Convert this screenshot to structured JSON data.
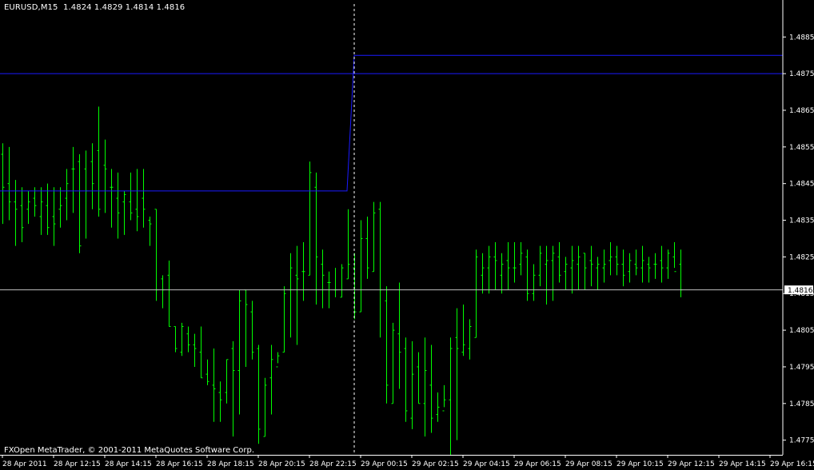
{
  "window": {
    "symbol_ohlc": "EURUSD,M15  1.4824 1.4829 1.4814 1.4816",
    "credit": "FXOpen MetaTrader, © 2001-2011 MetaQuotes Software Corp.",
    "current_price_label": "1.4816"
  },
  "colors": {
    "background": "#000000",
    "bars": "#00ff00",
    "axis": "#ffffff",
    "level_lines": "#1a1aff",
    "bid_line": "#c0c0c0",
    "separator": "#ffffff"
  },
  "chart_data": {
    "type": "ohlc-bar",
    "timeframe": "M15",
    "ylim": [
      1.4771,
      1.4894
    ],
    "y_ticks": [
      "1.4885",
      "1.4875",
      "1.4865",
      "1.4855",
      "1.4845",
      "1.4835",
      "1.4825",
      "1.4815",
      "1.4805",
      "1.4795",
      "1.4785",
      "1.4775"
    ],
    "y_tick_values": [
      1.4885,
      1.4875,
      1.4865,
      1.4855,
      1.4845,
      1.4835,
      1.4825,
      1.4815,
      1.4805,
      1.4795,
      1.4785,
      1.4775
    ],
    "x_ticks": [
      "28 Apr 2011",
      "28 Apr 12:15",
      "28 Apr 14:15",
      "28 Apr 16:15",
      "28 Apr 18:15",
      "28 Apr 20:15",
      "28 Apr 22:15",
      "29 Apr 00:15",
      "29 Apr 02:15",
      "29 Apr 04:15",
      "29 Apr 06:15",
      "29 Apr 08:15",
      "29 Apr 10:15",
      "29 Apr 12:15",
      "29 Apr 14:15",
      "29 Apr 16:15"
    ],
    "levels": [
      {
        "name": "prev-day-high",
        "y": 1.4875
      },
      {
        "name": "prev-day-low",
        "y": 1.4843
      },
      {
        "name": "day-high",
        "y": 1.488
      }
    ],
    "bid_price": 1.4816,
    "bars": [
      [
        1.4853,
        1.4856,
        1.4834,
        1.4844
      ],
      [
        1.4845,
        1.4855,
        1.4835,
        1.484
      ],
      [
        1.484,
        1.4846,
        1.4828,
        1.4838
      ],
      [
        1.4839,
        1.4844,
        1.4829,
        1.4833
      ],
      [
        1.4838,
        1.4843,
        1.4834,
        1.484
      ],
      [
        1.4841,
        1.4844,
        1.4836,
        1.4839
      ],
      [
        1.4836,
        1.4844,
        1.4831,
        1.484
      ],
      [
        1.4839,
        1.4845,
        1.4831,
        1.4833
      ],
      [
        1.4836,
        1.4844,
        1.4828,
        1.4834
      ],
      [
        1.4838,
        1.4844,
        1.4833,
        1.4839
      ],
      [
        1.4841,
        1.4849,
        1.4835,
        1.4845
      ],
      [
        1.4849,
        1.4855,
        1.4837,
        1.4849
      ],
      [
        1.4851,
        1.4853,
        1.4826,
        1.4828
      ],
      [
        1.4849,
        1.4854,
        1.483,
        1.4843
      ],
      [
        1.4851,
        1.4856,
        1.4838,
        1.4845
      ],
      [
        1.4854,
        1.4866,
        1.4836,
        1.4838
      ],
      [
        1.485,
        1.4857,
        1.4837,
        1.4849
      ],
      [
        1.4844,
        1.4849,
        1.4833,
        1.4844
      ],
      [
        1.4841,
        1.4848,
        1.483,
        1.4837
      ],
      [
        1.484,
        1.4843,
        1.4831,
        1.4842
      ],
      [
        1.484,
        1.4848,
        1.4835,
        1.4837
      ],
      [
        1.4838,
        1.4849,
        1.4832,
        1.4836
      ],
      [
        1.4841,
        1.4849,
        1.4833,
        1.4838
      ],
      [
        1.4835,
        1.4836,
        1.4828,
        1.4834
      ],
      [
        1.4838,
        1.4838,
        1.4813,
        1.4816
      ],
      [
        1.4819,
        1.482,
        1.4811,
        1.4816
      ],
      [
        1.482,
        1.4824,
        1.4806,
        1.4806
      ],
      [
        1.4806,
        1.4806,
        1.4799,
        1.48
      ],
      [
        1.4799,
        1.4807,
        1.4798,
        1.4806
      ],
      [
        1.4804,
        1.4806,
        1.4799,
        1.4801
      ],
      [
        1.4801,
        1.4804,
        1.4795,
        1.48
      ],
      [
        1.4799,
        1.4806,
        1.4792,
        1.4792
      ],
      [
        1.4793,
        1.4797,
        1.479,
        1.4791
      ],
      [
        1.479,
        1.48,
        1.478,
        1.4789
      ],
      [
        1.4788,
        1.4791,
        1.478,
        1.4786
      ],
      [
        1.4788,
        1.4797,
        1.4785,
        1.4797
      ],
      [
        1.48,
        1.4802,
        1.4776,
        1.4794
      ],
      [
        1.4794,
        1.4816,
        1.4782,
        1.4813
      ],
      [
        1.4816,
        1.4816,
        1.4795,
        1.4812
      ],
      [
        1.481,
        1.4813,
        1.4797,
        1.4799
      ],
      [
        1.48,
        1.4801,
        1.4774,
        1.4778
      ],
      [
        1.4776,
        1.4792,
        1.4776,
        1.479
      ],
      [
        1.4792,
        1.4801,
        1.4782,
        1.4797
      ],
      [
        1.4795,
        1.4799,
        1.4796,
        1.4798
      ],
      [
        1.4799,
        1.4817,
        1.4799,
        1.4815
      ],
      [
        1.4816,
        1.4826,
        1.4803,
        1.4822
      ],
      [
        1.482,
        1.4828,
        1.4801,
        1.4819
      ],
      [
        1.4821,
        1.4829,
        1.4813,
        1.4821
      ],
      [
        1.482,
        1.4851,
        1.482,
        1.4848
      ],
      [
        1.4844,
        1.4848,
        1.4812,
        1.4825
      ],
      [
        1.4823,
        1.4827,
        1.4811,
        1.482
      ],
      [
        1.4818,
        1.4821,
        1.4811,
        1.4818
      ],
      [
        1.4816,
        1.4822,
        1.4814,
        1.4816
      ],
      [
        1.4814,
        1.4823,
        1.4814,
        1.4822
      ],
      [
        1.4819,
        1.4838,
        1.4819,
        1.4823
      ],
      [
        1.4822,
        1.4826,
        1.4808,
        1.481
      ],
      [
        1.481,
        1.4835,
        1.481,
        1.483
      ],
      [
        1.483,
        1.4836,
        1.4819,
        1.4822
      ],
      [
        1.4821,
        1.484,
        1.4821,
        1.4837
      ],
      [
        1.4838,
        1.484,
        1.4803,
        1.4816
      ],
      [
        1.4813,
        1.4817,
        1.4785,
        1.479
      ],
      [
        1.4785,
        1.4807,
        1.4785,
        1.4805
      ],
      [
        1.4804,
        1.4818,
        1.4789,
        1.4799
      ],
      [
        1.48,
        1.4803,
        1.478,
        1.4783
      ],
      [
        1.4781,
        1.4802,
        1.4778,
        1.4793
      ],
      [
        1.4795,
        1.4799,
        1.4785,
        1.4785
      ],
      [
        1.4785,
        1.4803,
        1.4776,
        1.4794
      ],
      [
        1.479,
        1.4801,
        1.4777,
        1.4781
      ],
      [
        1.4782,
        1.4788,
        1.478,
        1.4784
      ],
      [
        1.4783,
        1.479,
        1.4784,
        1.4786
      ],
      [
        1.4786,
        1.4803,
        1.4771,
        1.48
      ],
      [
        1.4803,
        1.4811,
        1.4775,
        1.48
      ],
      [
        1.4799,
        1.4812,
        1.4798,
        1.4801
      ],
      [
        1.48,
        1.4808,
        1.4797,
        1.4806
      ],
      [
        1.4803,
        1.4827,
        1.4803,
        1.4825
      ],
      [
        1.482,
        1.4826,
        1.4815,
        1.4822
      ],
      [
        1.4822,
        1.4828,
        1.4815,
        1.4825
      ],
      [
        1.4825,
        1.4829,
        1.4816,
        1.4824
      ],
      [
        1.482,
        1.4826,
        1.4815,
        1.4823
      ],
      [
        1.4824,
        1.4829,
        1.4816,
        1.4822
      ],
      [
        1.4822,
        1.4829,
        1.4818,
        1.4822
      ],
      [
        1.4823,
        1.4829,
        1.482,
        1.4826
      ],
      [
        1.4825,
        1.4827,
        1.4813,
        1.4815
      ],
      [
        1.4815,
        1.4823,
        1.4813,
        1.482
      ],
      [
        1.482,
        1.4828,
        1.4817,
        1.4826
      ],
      [
        1.4823,
        1.4828,
        1.4812,
        1.4824
      ],
      [
        1.4824,
        1.4828,
        1.4813,
        1.4826
      ],
      [
        1.4825,
        1.4829,
        1.4818,
        1.482
      ],
      [
        1.4821,
        1.4825,
        1.4816,
        1.4823
      ],
      [
        1.4822,
        1.4828,
        1.4815,
        1.4824
      ],
      [
        1.4823,
        1.4828,
        1.4816,
        1.4825
      ],
      [
        1.4826,
        1.4826,
        1.4816,
        1.4822
      ],
      [
        1.4824,
        1.4828,
        1.4817,
        1.4823
      ],
      [
        1.4822,
        1.4825,
        1.4816,
        1.4823
      ],
      [
        1.4822,
        1.4827,
        1.4818,
        1.4823
      ],
      [
        1.4824,
        1.4829,
        1.482,
        1.4825
      ],
      [
        1.4825,
        1.4828,
        1.482,
        1.4823
      ],
      [
        1.4823,
        1.4827,
        1.4817,
        1.482
      ],
      [
        1.4821,
        1.4826,
        1.4818,
        1.4824
      ],
      [
        1.4823,
        1.4827,
        1.482,
        1.4822
      ],
      [
        1.4822,
        1.4828,
        1.4818,
        1.4824
      ],
      [
        1.4823,
        1.4825,
        1.4818,
        1.4822
      ],
      [
        1.4823,
        1.4826,
        1.4819,
        1.4823
      ],
      [
        1.4824,
        1.4828,
        1.4818,
        1.4822
      ],
      [
        1.4822,
        1.4827,
        1.4819,
        1.4826
      ],
      [
        1.4825,
        1.4829,
        1.4822,
        1.4821
      ],
      [
        1.4823,
        1.4827,
        1.4814,
        1.4816
      ]
    ]
  }
}
